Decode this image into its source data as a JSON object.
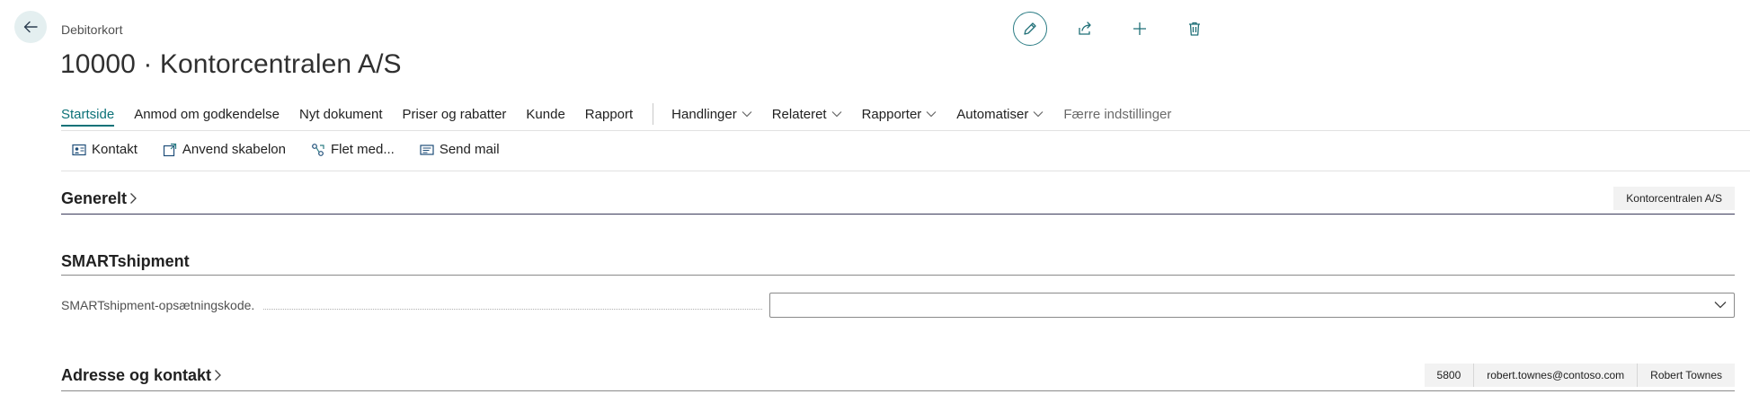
{
  "header": {
    "breadcrumb": "Debitorkort",
    "title": "10000 · Kontorcentralen A/S"
  },
  "menu": {
    "items": [
      {
        "label": "Startside",
        "active": true
      },
      {
        "label": "Anmod om godkendelse"
      },
      {
        "label": "Nyt dokument"
      },
      {
        "label": "Priser og rabatter"
      },
      {
        "label": "Kunde"
      },
      {
        "label": "Rapport"
      }
    ],
    "dropdowns": [
      {
        "label": "Handlinger"
      },
      {
        "label": "Relateret"
      },
      {
        "label": "Rapporter"
      },
      {
        "label": "Automatiser"
      }
    ],
    "fewer": "Færre indstillinger"
  },
  "subbar": {
    "items": [
      {
        "label": "Kontakt",
        "icon": "contact-card-icon"
      },
      {
        "label": "Anvend skabelon",
        "icon": "apply-template-icon"
      },
      {
        "label": "Flet med...",
        "icon": "merge-icon"
      },
      {
        "label": "Send mail",
        "icon": "mail-icon"
      }
    ]
  },
  "sections": {
    "general": {
      "title": "Generelt",
      "chips": [
        "Kontorcentralen A/S"
      ]
    },
    "smartshipment": {
      "title": "SMARTshipment",
      "field_label": "SMARTshipment-opsætningskode.",
      "field_value": ""
    },
    "address": {
      "title": "Adresse og kontakt",
      "chips": [
        "5800",
        "robert.townes@contoso.com",
        "Robert Townes"
      ]
    }
  },
  "colors": {
    "accent": "#0d7278",
    "back_bg": "#e4eff0"
  }
}
